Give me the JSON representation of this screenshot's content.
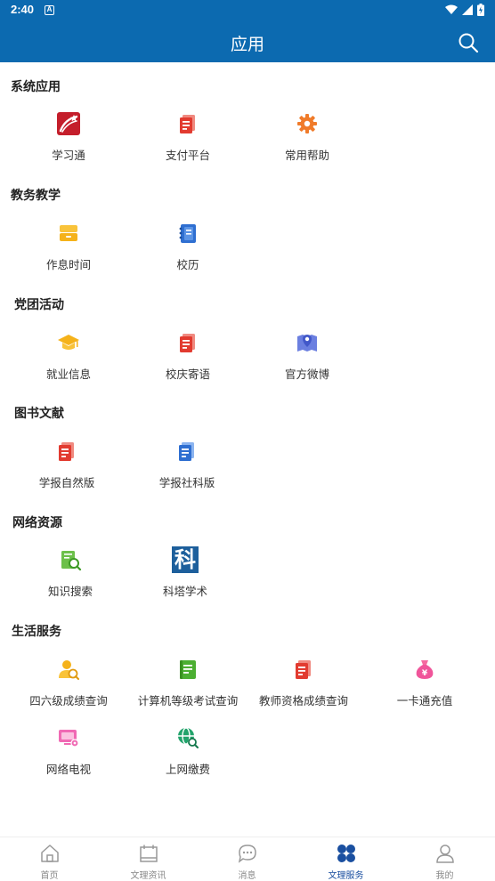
{
  "status_bar": {
    "time": "2:40",
    "notif_letter": "A"
  },
  "header": {
    "title": "应用"
  },
  "sections": [
    {
      "title": "系统应用",
      "items": [
        "学习通",
        "支付平台",
        "常用帮助"
      ]
    },
    {
      "title": "教务教学",
      "items": [
        "作息时间",
        "校历"
      ]
    },
    {
      "title": "党团活动",
      "items": [
        "就业信息",
        "校庆寄语",
        "官方微博"
      ]
    },
    {
      "title": "图书文献",
      "items": [
        "学报自然版",
        "学报社科版"
      ]
    },
    {
      "title": "网络资源",
      "items": [
        "知识搜索",
        "科塔学术"
      ]
    },
    {
      "title": "生活服务",
      "items": [
        "四六级成绩查询",
        "计算机等级考试查询",
        "教师资格成绩查询",
        "一卡通充值",
        "网络电视",
        "上网缴费"
      ]
    }
  ],
  "icon_glyphs": {
    "keta": "科"
  },
  "bottom_nav": [
    {
      "label": "首页",
      "active": false
    },
    {
      "label": "文理资讯",
      "active": false
    },
    {
      "label": "消息",
      "active": false
    },
    {
      "label": "文理服务",
      "active": true
    },
    {
      "label": "我的",
      "active": false
    }
  ],
  "colors": {
    "primary": "#0c6ab0",
    "active_nav": "#1a4fa0"
  }
}
